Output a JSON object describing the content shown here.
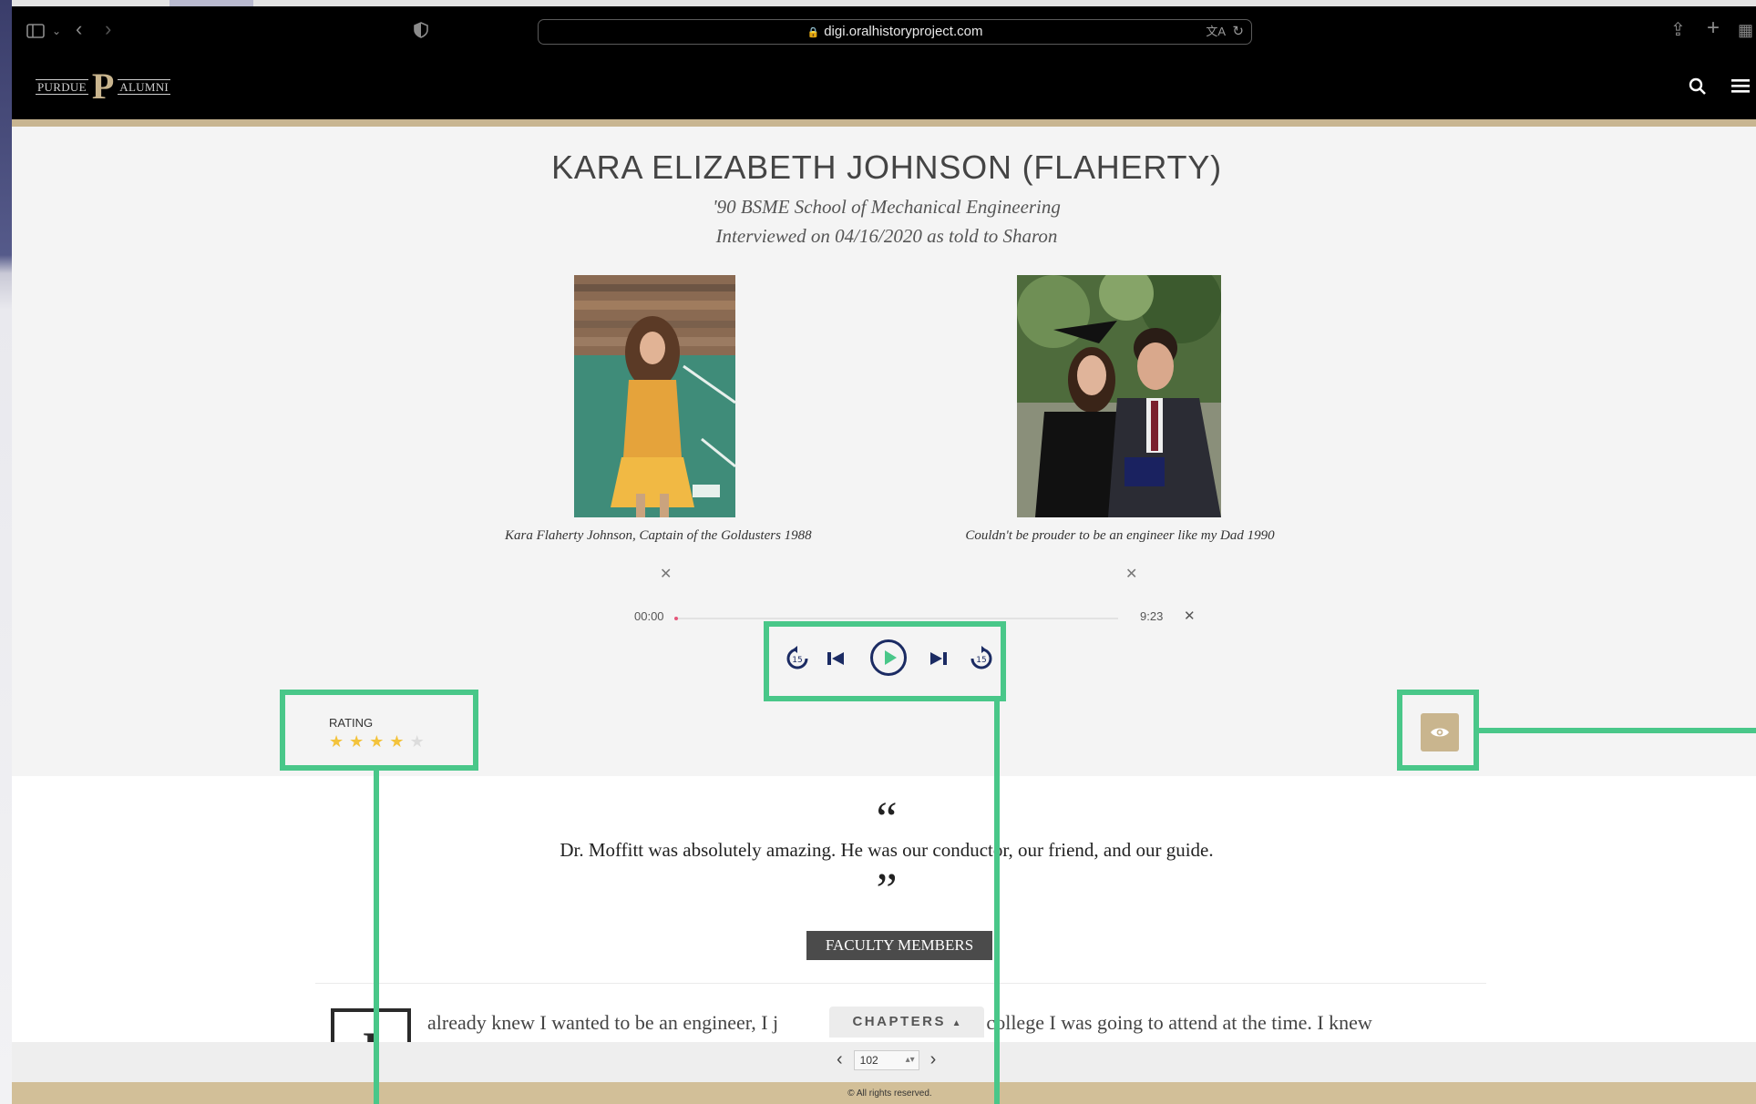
{
  "browser": {
    "url": "digi.oralhistoryproject.com"
  },
  "site": {
    "logo_left": "PURDUE",
    "logo_mark": "P",
    "logo_right": "ALUMNI"
  },
  "profile": {
    "name": "KARA ELIZABETH JOHNSON (FLAHERTY)",
    "degree": "'90 BSME School of Mechanical Engineering",
    "interview": "Interviewed on 04/16/2020 as told to Sharon",
    "photos": [
      {
        "caption": "Kara Flaherty Johnson, Captain of the Goldusters 1988"
      },
      {
        "caption": "Couldn't be prouder to be an engineer like my Dad 1990"
      }
    ]
  },
  "audio": {
    "current_time": "00:00",
    "duration": "9:23",
    "progress": 0.0
  },
  "rating": {
    "label": "RATING",
    "value": 4,
    "max": 5
  },
  "quote": {
    "open_mark": "“",
    "text": "Dr. Moffitt was absolutely amazing. He was our conductor, our friend, and our guide.",
    "close_mark": "”",
    "tag": "FACULTY MEMBERS"
  },
  "story": {
    "drop_cap": "I",
    "text_before": "already knew I wanted to be an engineer, I j",
    "text_after": "what college I was going to attend at the time. I knew"
  },
  "chapters": {
    "label": "CHAPTERS"
  },
  "pagination": {
    "page": "102"
  },
  "footer": {
    "copyright": "© All rights reserved."
  },
  "colors": {
    "highlight": "#49c789",
    "gold": "#c9b58e",
    "player_navy": "#1b2b63",
    "star": "#f3c33c"
  }
}
